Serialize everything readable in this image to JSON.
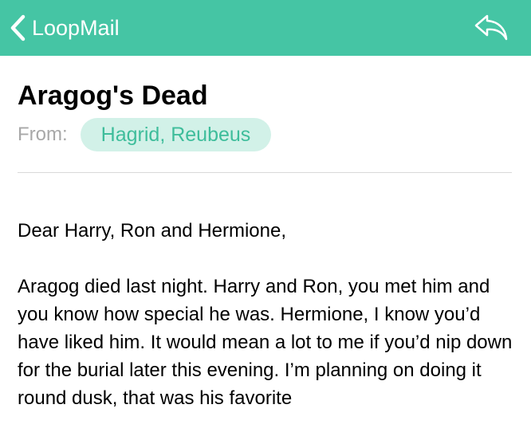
{
  "app": {
    "back_label": "LoopMail",
    "accent_color": "#45c5a4",
    "back_icon": "chevron-left-icon",
    "reply_icon": "reply-arrow-icon"
  },
  "email": {
    "subject": "Aragog's Dead",
    "from_label": "From:",
    "sender": "Hagrid, Reubeus",
    "greeting": "Dear Harry, Ron and Hermione,",
    "paragraph": "Aragog died last night. Harry and Ron, you met him and you know how special he was. Hermione, I know you’d have liked him. It would mean a lot to me if you’d nip down for the burial later this evening. I’m planning on doing it round dusk, that was his favorite"
  }
}
